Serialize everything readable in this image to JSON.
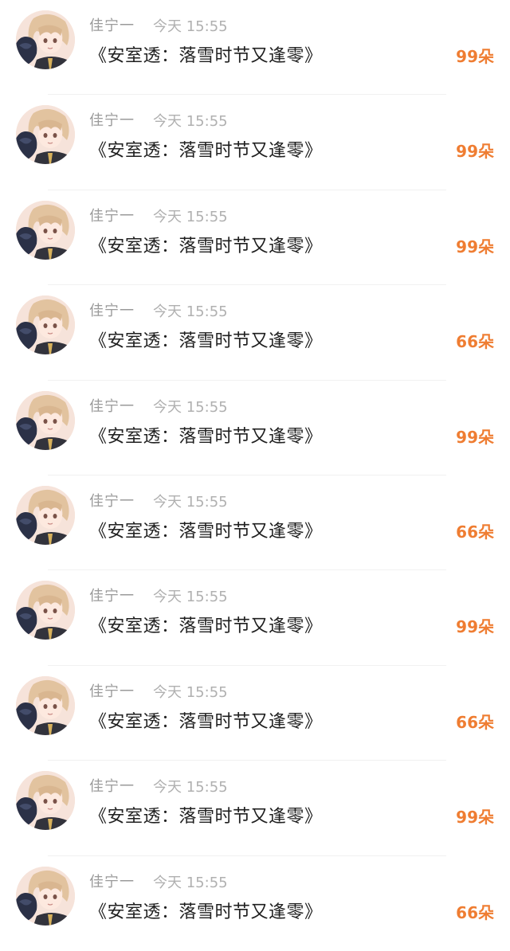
{
  "comments": [
    {
      "user": "佳宁一",
      "time": "今天 15:55",
      "message": "《安室透：落雪时节又逢零》",
      "gift": "99朵"
    },
    {
      "user": "佳宁一",
      "time": "今天 15:55",
      "message": "《安室透：落雪时节又逢零》",
      "gift": "99朵"
    },
    {
      "user": "佳宁一",
      "time": "今天 15:55",
      "message": "《安室透：落雪时节又逢零》",
      "gift": "99朵"
    },
    {
      "user": "佳宁一",
      "time": "今天 15:55",
      "message": "《安室透：落雪时节又逢零》",
      "gift": "66朵"
    },
    {
      "user": "佳宁一",
      "time": "今天 15:55",
      "message": "《安室透：落雪时节又逢零》",
      "gift": "99朵"
    },
    {
      "user": "佳宁一",
      "time": "今天 15:55",
      "message": "《安室透：落雪时节又逢零》",
      "gift": "66朵"
    },
    {
      "user": "佳宁一",
      "time": "今天 15:55",
      "message": "《安室透：落雪时节又逢零》",
      "gift": "99朵"
    },
    {
      "user": "佳宁一",
      "time": "今天 15:55",
      "message": "《安室透：落雪时节又逢零》",
      "gift": "66朵"
    },
    {
      "user": "佳宁一",
      "time": "今天 15:55",
      "message": "《安室透：落雪时节又逢零》",
      "gift": "99朵"
    },
    {
      "user": "佳宁一",
      "time": "今天 15:55",
      "message": "《安室透：落雪时节又逢零》",
      "gift": "66朵"
    }
  ],
  "colors": {
    "gift": "#ef7d32",
    "username": "#9a9a9a",
    "time": "#b0b0b0",
    "message": "#1f1f1f"
  },
  "icons": {
    "avatar": "anime-avatar-icon"
  }
}
